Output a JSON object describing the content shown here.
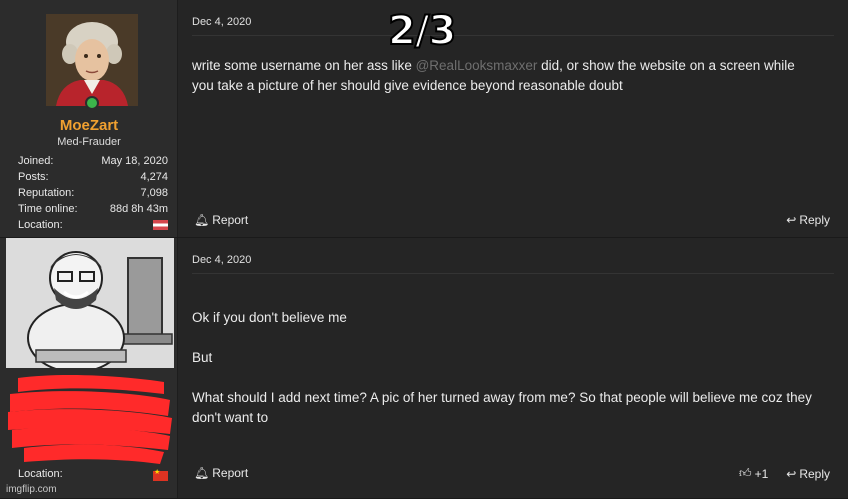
{
  "overlay": {
    "page_indicator": "2/3",
    "watermark": "imgflip.com"
  },
  "posts": [
    {
      "author": {
        "username": "MoeZart",
        "title": "Med-Frauder",
        "stats": [
          {
            "label": "Joined:",
            "value": "May 18, 2020"
          },
          {
            "label": "Posts:",
            "value": "4,274"
          },
          {
            "label": "Reputation:",
            "value": "7,098"
          },
          {
            "label": "Time online:",
            "value": "88d 8h 43m"
          },
          {
            "label": "Location:",
            "value": ""
          }
        ],
        "flag": "austria-flag-icon"
      },
      "date": "Dec 4, 2020",
      "message": {
        "part1": "write some username on her ass like ",
        "mention": "@RealLooksmaxxer",
        "part2": " did, or show the website on a screen while you take a picture of her should give evidence beyond reasonable doubt"
      },
      "actions": {
        "report": "Report",
        "reply": "Reply"
      }
    },
    {
      "author": {
        "location_label": "Location:",
        "flag": "china-flag-icon"
      },
      "date": "Dec 4, 2020",
      "message_lines": [
        "Ok if you don't believe me",
        "",
        "But",
        "",
        "What should I add next time? A pic of her turned away from me? So that people will believe me coz they don't want to"
      ],
      "actions": {
        "report": "Report",
        "like_count": "+1",
        "reply": "Reply"
      }
    }
  ],
  "colors": {
    "username": "#f0a030",
    "online": "#3cb44b",
    "redaction": "#ff2a2a"
  }
}
